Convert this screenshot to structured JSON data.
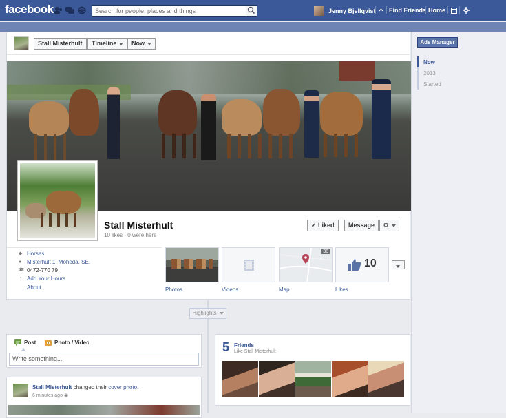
{
  "topbar": {
    "logo": "facebook",
    "search_placeholder": "Search for people, places and things",
    "user_name": "Jenny Bjellqvist",
    "find_friends": "Find Friends",
    "home": "Home"
  },
  "pagebar": {
    "page_name": "Stall Misterhult",
    "timeline_label": "Timeline",
    "now_label": "Now"
  },
  "profile": {
    "name": "Stall Misterhult",
    "meta": "10 likes · 0 were here",
    "liked_label": "Liked",
    "message_label": "Message"
  },
  "info": {
    "category": "Horses",
    "address": "Misterhult 1, Moheda, SE.",
    "phone": "0472-770 79",
    "add_hours": "Add Your Hours",
    "about": "About"
  },
  "apps": {
    "photos": "Photos",
    "videos": "Videos",
    "map": "Map",
    "likes": "Likes",
    "likes_count": "10",
    "map_badge": "38"
  },
  "right": {
    "ads_manager": "Ads Manager",
    "scrubber": [
      "Now",
      "2013",
      "Started"
    ]
  },
  "timeline": {
    "highlights": "Highlights"
  },
  "composer": {
    "post_tab": "Post",
    "photo_tab": "Photo / Video",
    "placeholder": "Write something..."
  },
  "story": {
    "author": "Stall Misterhult",
    "action_pre": " changed their ",
    "action_link": "cover photo",
    "action_post": ".",
    "time": "6 minutes ago"
  },
  "friends": {
    "count": "5",
    "title": "Friends",
    "subtitle": "Like Stall Misterhult"
  },
  "colors": {
    "brand_blue": "#3b5998",
    "strip_blue": "#6d84b4",
    "page_bg": "#e9ebee"
  }
}
